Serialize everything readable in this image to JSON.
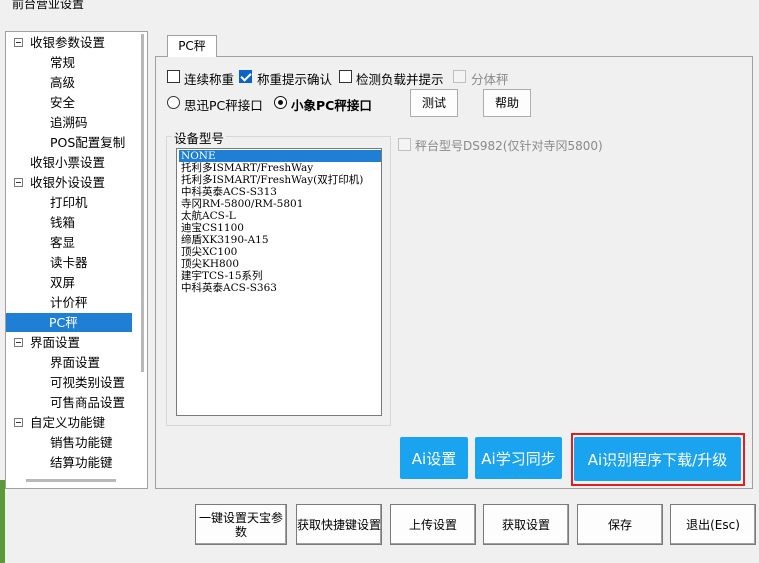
{
  "window": {
    "title": "前台营业设置"
  },
  "tree": {
    "items": [
      {
        "label": "收银参数设置",
        "level": 0,
        "expandable": true
      },
      {
        "label": "常规",
        "level": 1
      },
      {
        "label": "高级",
        "level": 1
      },
      {
        "label": "安全",
        "level": 1
      },
      {
        "label": "追溯码",
        "level": 1
      },
      {
        "label": "POS配置复制",
        "level": 1
      },
      {
        "label": "收银小票设置",
        "level": 0,
        "expandable": false
      },
      {
        "label": "收银外设设置",
        "level": 0,
        "expandable": true
      },
      {
        "label": "打印机",
        "level": 1
      },
      {
        "label": "钱箱",
        "level": 1
      },
      {
        "label": "客显",
        "level": 1
      },
      {
        "label": "读卡器",
        "level": 1
      },
      {
        "label": "双屏",
        "level": 1
      },
      {
        "label": "计价秤",
        "level": 1
      },
      {
        "label": "PC秤",
        "level": 1,
        "selected": true
      },
      {
        "label": "界面设置",
        "level": 0,
        "expandable": true
      },
      {
        "label": "界面设置",
        "level": 1
      },
      {
        "label": "可视类别设置",
        "level": 1
      },
      {
        "label": "可售商品设置",
        "level": 1
      },
      {
        "label": "自定义功能键",
        "level": 0,
        "expandable": true
      },
      {
        "label": "销售功能键",
        "level": 1
      },
      {
        "label": "结算功能键",
        "level": 1
      }
    ]
  },
  "tab": {
    "label": "PC秤"
  },
  "options": {
    "continuous_weigh": {
      "label": "连续称重",
      "checked": false
    },
    "reweigh_prompt": {
      "label": "称重提示确认",
      "checked": true
    },
    "load_detect": {
      "label": "检测负载并提示",
      "checked": false
    },
    "split_scale": {
      "label": "分体秤",
      "checked": false,
      "disabled": true
    },
    "sixun_interface": {
      "label": "思迅PC秤接口",
      "selected": false
    },
    "xiaoxiang_interface": {
      "label": "小象PC秤接口",
      "selected": true
    },
    "test_button": "测试",
    "help_button": "帮助"
  },
  "device_model": {
    "group_label": "设备型号",
    "items": [
      "NONE",
      "托利多ISMART/FreshWay",
      "托利多ISMART/FreshWay(双打印机)",
      "中科英泰ACS-S313",
      "寺冈RM-5800/RM-5801",
      "太航ACS-L",
      "迪宝CS1100",
      "缔盾XK3190-A15",
      "顶尖XC100",
      "顶尖KH800",
      "建宇TCS-15系列",
      "中科英泰ACS-S363"
    ],
    "selected_index": 0
  },
  "platform_scale": {
    "label": "秤台型号DS982(仅针对寺冈5800)",
    "checked": false,
    "disabled": true
  },
  "ai_buttons": {
    "ai_settings": "Ai设置",
    "ai_sync": "Ai学习同步",
    "ai_download": "Ai识别程序下载/升级"
  },
  "bottom_buttons": {
    "one_key_setup": "一键设置天宝参数",
    "get_hotkeys": "获取快捷键设置",
    "upload": "上传设置",
    "fetch": "获取设置",
    "save": "保存",
    "exit": "退出(Esc)"
  },
  "colors": {
    "accent": "#1e7fd4",
    "ai_button": "#1aa3ee",
    "highlight_frame": "#e02020"
  }
}
